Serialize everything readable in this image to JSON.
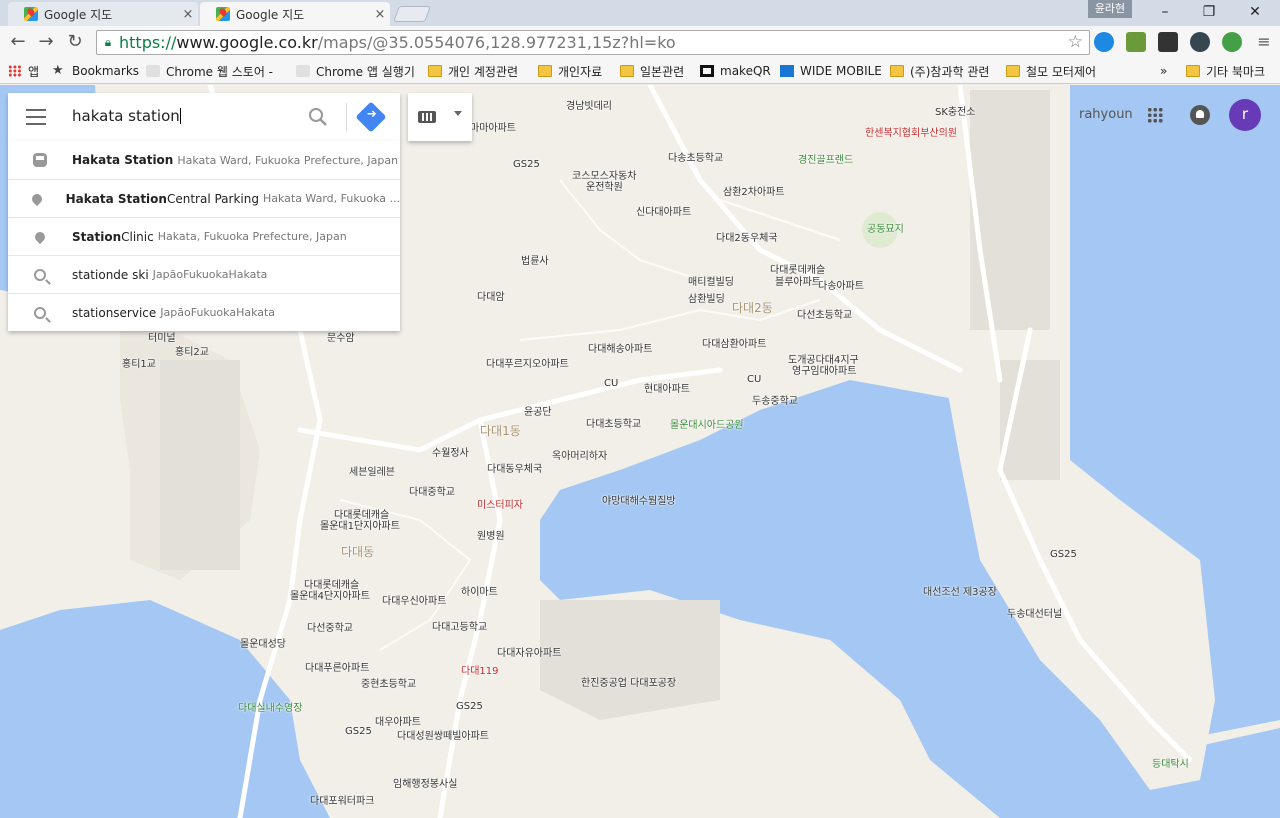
{
  "browser": {
    "tabs": [
      {
        "title": "Google 지도",
        "close": "×"
      },
      {
        "title": "Google 지도",
        "close": "×"
      }
    ],
    "profile": "윤라현",
    "url": {
      "scheme": "https://",
      "host": "www.google.co.kr",
      "path": "/maps/@35.0554076,128.977231,15z?hl=ko"
    },
    "bookmarks": [
      "앱",
      "Bookmarks",
      "Chrome 웹 스토어 -",
      "Chrome 앱 실행기",
      "개인 계정관련",
      "개인자료",
      "일본관련",
      "makeQR",
      "WIDE MOBILE",
      "(주)참과학 관련",
      "철모 모터제어",
      "»",
      "기타 북마크"
    ]
  },
  "search": {
    "query": "hakata station",
    "suggestions": [
      {
        "icon": "train-icon",
        "main": "Hakata Station",
        "rest": "",
        "secondary": "Hakata Ward, Fukuoka Prefecture, Japan"
      },
      {
        "icon": "pin-icon",
        "main": "Hakata Station",
        "rest": " Central Parking",
        "secondary": "Hakata Ward, Fukuoka ..."
      },
      {
        "icon": "pin-icon",
        "main": "Station",
        "rest": " Clinic",
        "secondary": "Hakata, Fukuoka Prefecture, Japan"
      },
      {
        "icon": "search-icon",
        "main": "station",
        "rest": " de ski",
        "secondary": "JapãoFukuokaHakata"
      },
      {
        "icon": "search-icon",
        "main": "station",
        "rest": " service",
        "secondary": "JapãoFukuokaHakata"
      }
    ]
  },
  "account": {
    "name": "rahyoun",
    "initial": "r"
  },
  "map_labels": {
    "l1": "경남빗데리",
    "l2": "SK충전소",
    "l3": "한센복지협회부산의원",
    "l4": "마마아파트",
    "l5": "다송초등학교",
    "l6": "GS25",
    "l7": "경진골프랜드",
    "l8": "코스모스자동차",
    "l9": "운전학원",
    "l10": "삼환2차아파트",
    "l11": "신다대아파트",
    "l12": "다대2동우체국",
    "l13": "공동묘지",
    "l14": "법륜사",
    "l15": "매티컬빌딩",
    "l16": "다대롯데캐슬",
    "l17": "블루아파트",
    "l18": "다송아파트",
    "l19": "삼환빌딩",
    "l20": "다대2동",
    "l21": "다대암",
    "l22": "다선초등학교",
    "l23": "문수암",
    "l24": "다대해송아파트",
    "l25": "다대삼환아파트",
    "l26": "터미널",
    "l27": "홍티2교",
    "l28": "홍티1교",
    "l29": "다대푸르지오아파트",
    "l30": "도개공다대4지구",
    "l31": "영구임대아파트",
    "l32": "CU",
    "l33": "현대아파트",
    "l34": "CU",
    "l35": "두송중학교",
    "l36": "윤공단",
    "l37": "다대1동",
    "l38": "다대초등학교",
    "l39": "몰운대시아드공원",
    "l40": "수월정사",
    "l41": "옥아머리하자",
    "l42": "세븐일레븐",
    "l43": "다대동우체국",
    "l44": "다대중학교",
    "l45": "미스터피자",
    "l46": "야망대해수뭠질방",
    "l47": "다대롯데캐슬",
    "l48": "몰운대1단지아파트",
    "l49": "원병원",
    "l50": "다대동",
    "l51": "다대롯데캐슬",
    "l52": "몰운대4단지아파트",
    "l53": "하이마트",
    "l54": "다대우신아파트",
    "l55": "다선중학교",
    "l56": "다대고등학교",
    "l57": "몰운대성당",
    "l58": "다대자유아파트",
    "l59": "다대푸른아파트",
    "l60": "다대119",
    "l61": "한진중공업 다대포공장",
    "l62": "중현초등학교",
    "l63": "GS25",
    "l64": "다대실내수영장",
    "l65": "대우아파트",
    "l66": "GS25",
    "l67": "다대성원쌍떼빌아파트",
    "l68": "임해행정봉사실",
    "l69": "다대포워터파크",
    "l70": "대선조선 제3공장",
    "l71": "GS25",
    "l72": "두송대선터널",
    "l73": "등대탁시"
  }
}
